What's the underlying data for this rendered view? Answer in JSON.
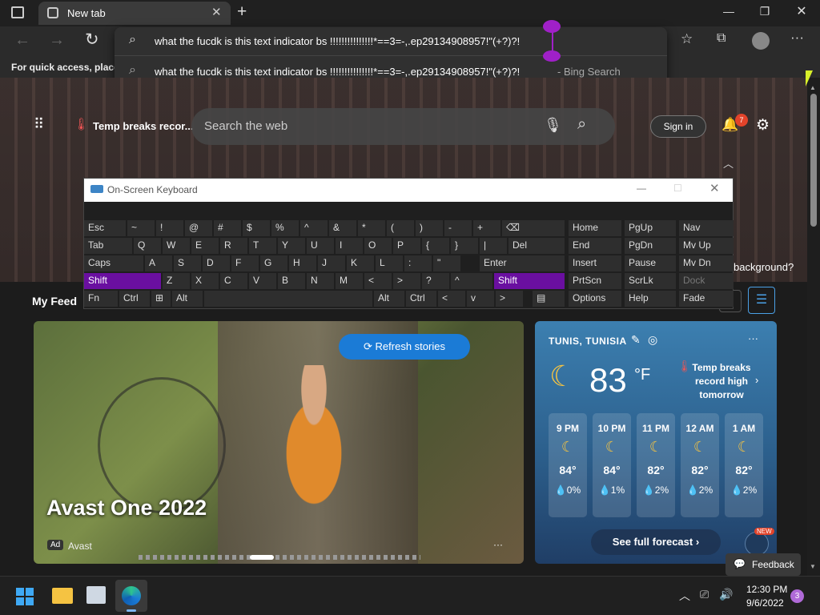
{
  "browser": {
    "tab_title": "New tab",
    "address_text": "what the fucdk is this text indicator bs !!!!!!!!!!!!!!!*==3=-,.ep29134908957!\"(+?)?!",
    "suggestion_text": "what the fucdk is this text indicator bs !!!!!!!!!!!!!!!*==3=-,.ep29134908957!\"(+?)?!",
    "suggestion_source": "- Bing Search",
    "favbar_hint": "For quick access, place y"
  },
  "newtab": {
    "headline": "Temp breaks recor...",
    "search_placeholder": "Search the web",
    "sign_in": "Sign in",
    "notif_count": "7",
    "bg_question": "background?",
    "my_feed": "My Feed"
  },
  "hero": {
    "refresh": "Refresh stories",
    "title": "Avast One 2022",
    "ad_badge": "Ad",
    "advertiser": "Avast",
    "more": "···"
  },
  "weather": {
    "location": "TUNIS, TUNISIA",
    "temp": "83",
    "unit": "°F",
    "alert": "Temp breaks record high tomorrow",
    "hours": [
      {
        "time": "9 PM",
        "temp": "84°",
        "precip": "0%"
      },
      {
        "time": "10 PM",
        "temp": "84°",
        "precip": "1%"
      },
      {
        "time": "11 PM",
        "temp": "82°",
        "precip": "2%"
      },
      {
        "time": "12 AM",
        "temp": "82°",
        "precip": "2%"
      },
      {
        "time": "1 AM",
        "temp": "82°",
        "precip": "2%"
      }
    ],
    "forecast": "See full forecast",
    "new_badge": "NEW"
  },
  "osk": {
    "title": "On-Screen Keyboard",
    "rows": [
      [
        [
          "Esc",
          0,
          52
        ],
        [
          "~",
          54,
          34
        ],
        [
          "!",
          90,
          34
        ],
        [
          "@",
          126,
          34
        ],
        [
          "#",
          162,
          34
        ],
        [
          "$",
          198,
          34
        ],
        [
          "%",
          234,
          34
        ],
        [
          "^",
          270,
          34
        ],
        [
          "&",
          306,
          34
        ],
        [
          "*",
          342,
          34
        ],
        [
          "(",
          378,
          34
        ],
        [
          ")",
          414,
          34
        ],
        [
          "-",
          450,
          34
        ],
        [
          "+",
          486,
          34
        ],
        [
          "⌫",
          522,
          78
        ]
      ],
      [
        [
          "Tab",
          0,
          60
        ],
        [
          "Q",
          62,
          34
        ],
        [
          "W",
          98,
          34
        ],
        [
          "E",
          134,
          34
        ],
        [
          "R",
          170,
          34
        ],
        [
          "T",
          206,
          34
        ],
        [
          "Y",
          242,
          34
        ],
        [
          "U",
          278,
          34
        ],
        [
          "I",
          314,
          34
        ],
        [
          "O",
          350,
          34
        ],
        [
          "P",
          386,
          34
        ],
        [
          "{",
          422,
          34
        ],
        [
          "}",
          458,
          34
        ],
        [
          "|",
          494,
          34
        ],
        [
          "Del",
          530,
          70
        ]
      ],
      [
        [
          "Caps",
          0,
          74
        ],
        [
          "A",
          76,
          34
        ],
        [
          "S",
          112,
          34
        ],
        [
          "D",
          148,
          34
        ],
        [
          "F",
          184,
          34
        ],
        [
          "G",
          220,
          34
        ],
        [
          "H",
          256,
          34
        ],
        [
          "J",
          292,
          34
        ],
        [
          "K",
          328,
          34
        ],
        [
          "L",
          364,
          34
        ],
        [
          ":",
          400,
          34
        ],
        [
          "\"",
          436,
          34
        ],
        [
          "Enter",
          494,
          106
        ]
      ],
      [
        [
          "Shift",
          0,
          96,
          1
        ],
        [
          "Z",
          98,
          34
        ],
        [
          "X",
          134,
          34
        ],
        [
          "C",
          170,
          34
        ],
        [
          "V",
          206,
          34
        ],
        [
          "B",
          242,
          34
        ],
        [
          "N",
          278,
          34
        ],
        [
          "M",
          314,
          34
        ],
        [
          "<",
          350,
          34
        ],
        [
          ">",
          386,
          34
        ],
        [
          "?",
          422,
          34
        ],
        [
          "^",
          458,
          52
        ],
        [
          "Shift",
          512,
          88,
          1
        ]
      ],
      [
        [
          "Fn",
          0,
          42
        ],
        [
          "Ctrl",
          44,
          38
        ],
        [
          "⊞",
          84,
          24
        ],
        [
          "Alt",
          110,
          38
        ],
        [
          "",
          150,
          210
        ],
        [
          "Alt",
          362,
          38
        ],
        [
          "Ctrl",
          402,
          38
        ],
        [
          "<",
          442,
          34
        ],
        [
          "v",
          478,
          34
        ],
        [
          ">",
          514,
          34
        ],
        [
          "▤",
          560,
          40
        ]
      ]
    ],
    "side": [
      [
        [
          "Home",
          0,
          66
        ],
        [
          "PgUp",
          70,
          64
        ],
        [
          "Nav",
          138,
          68
        ]
      ],
      [
        [
          "End",
          0,
          66
        ],
        [
          "PgDn",
          70,
          64
        ],
        [
          "Mv Up",
          138,
          68
        ]
      ],
      [
        [
          "Insert",
          0,
          66
        ],
        [
          "Pause",
          70,
          64
        ],
        [
          "Mv Dn",
          138,
          68
        ]
      ],
      [
        [
          "PrtScn",
          0,
          66
        ],
        [
          "ScrLk",
          70,
          64
        ],
        [
          "Dock",
          138,
          68
        ]
      ],
      [
        [
          "Options",
          0,
          66
        ],
        [
          "Help",
          70,
          64
        ],
        [
          "Fade",
          138,
          68
        ]
      ]
    ]
  },
  "feedback": "Feedback",
  "taskbar": {
    "time": "12:30 PM",
    "date": "9/6/2022",
    "badge": "3"
  }
}
